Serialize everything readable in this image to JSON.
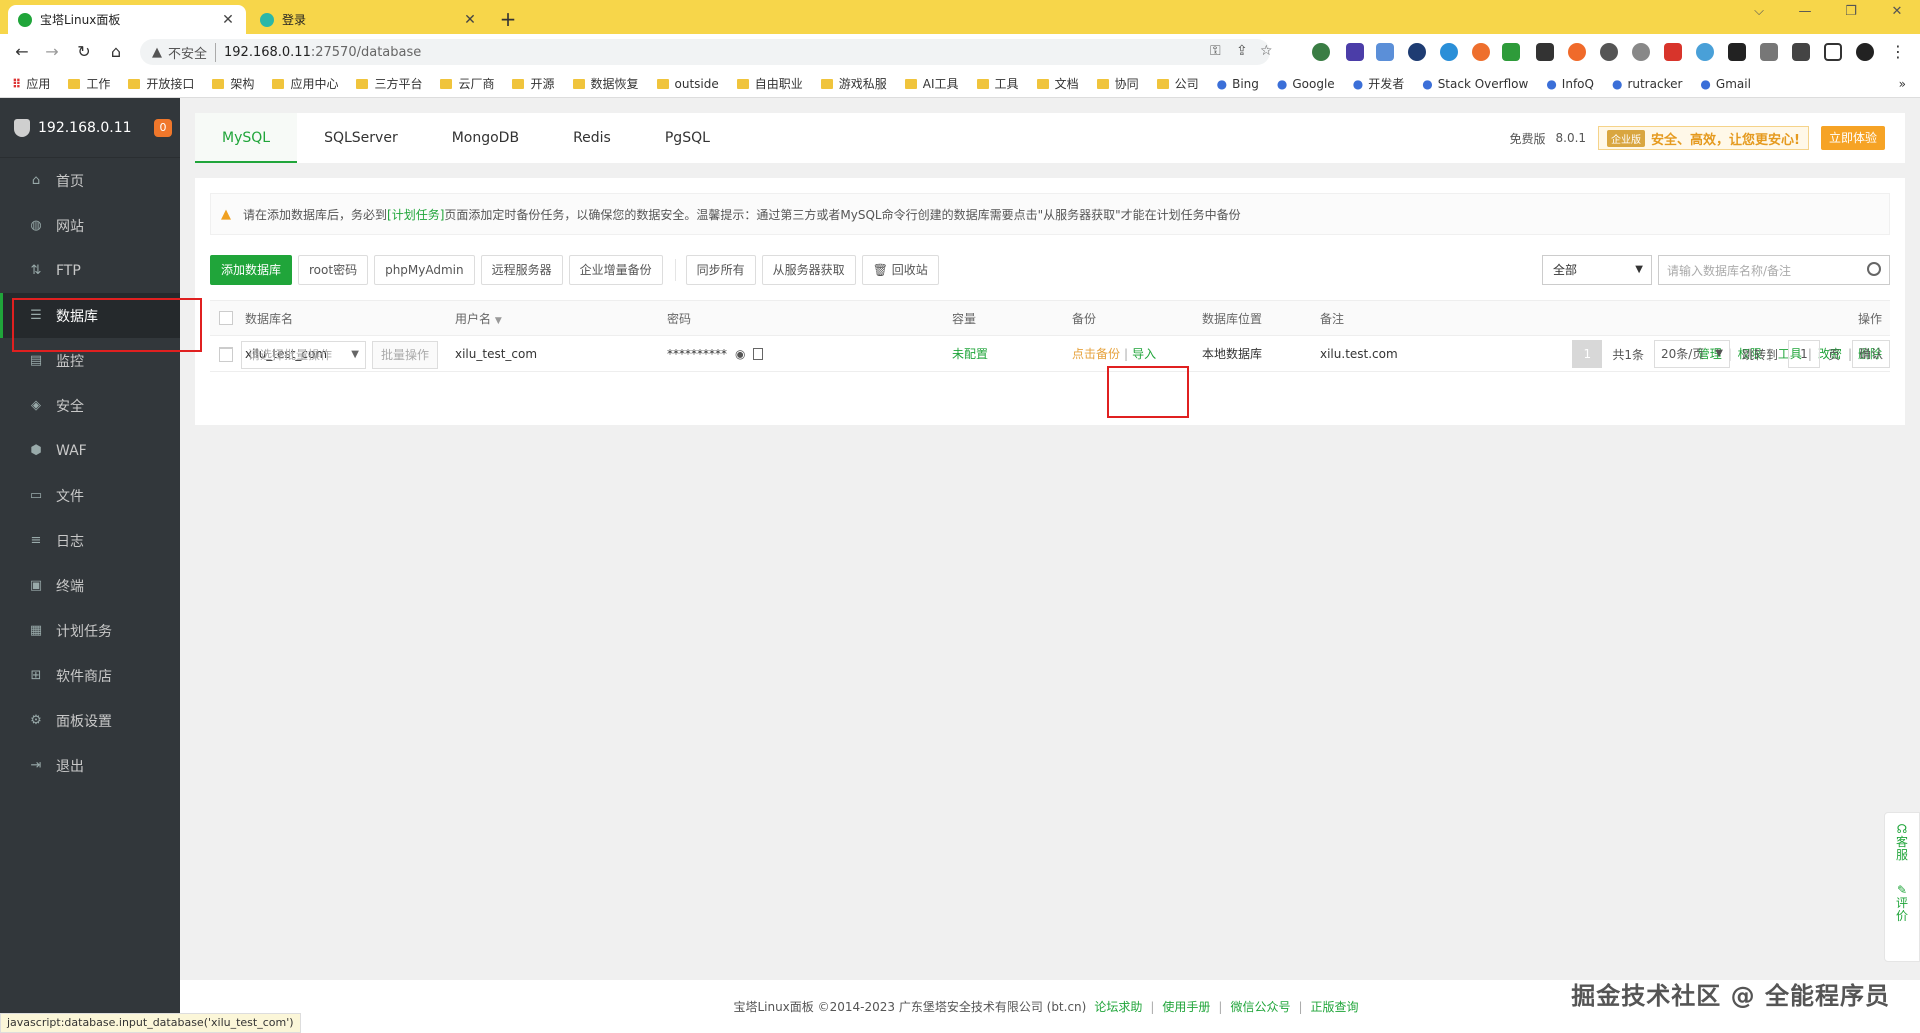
{
  "browser": {
    "tabs": [
      {
        "title": "宝塔Linux面板",
        "active": true
      },
      {
        "title": "登录",
        "active": false
      }
    ],
    "new_tab": "+",
    "window_controls": [
      "⌵",
      "—",
      "❐",
      "✕"
    ],
    "security_label": "不安全",
    "url_host": "192.168.0.11",
    "url_path": ":27570/database",
    "bookmarks": [
      {
        "label": "应用",
        "type": "apps"
      },
      {
        "label": "工作",
        "type": "folder"
      },
      {
        "label": "开放接口",
        "type": "folder"
      },
      {
        "label": "架构",
        "type": "folder"
      },
      {
        "label": "应用中心",
        "type": "folder"
      },
      {
        "label": "三方平台",
        "type": "folder"
      },
      {
        "label": "云厂商",
        "type": "folder"
      },
      {
        "label": "开源",
        "type": "folder"
      },
      {
        "label": "数据恢复",
        "type": "folder"
      },
      {
        "label": "outside",
        "type": "folder"
      },
      {
        "label": "自由职业",
        "type": "folder"
      },
      {
        "label": "游戏私服",
        "type": "folder"
      },
      {
        "label": "AI工具",
        "type": "folder"
      },
      {
        "label": "工具",
        "type": "folder"
      },
      {
        "label": "文档",
        "type": "folder"
      },
      {
        "label": "协同",
        "type": "folder"
      },
      {
        "label": "公司",
        "type": "folder"
      },
      {
        "label": "Bing",
        "type": "site"
      },
      {
        "label": "Google",
        "type": "site"
      },
      {
        "label": "开发者",
        "type": "site"
      },
      {
        "label": "Stack Overflow",
        "type": "site"
      },
      {
        "label": "InfoQ",
        "type": "site"
      },
      {
        "label": "rutracker",
        "type": "site"
      },
      {
        "label": "Gmail",
        "type": "site"
      }
    ],
    "bookmarks_more": "»",
    "status_url": "javascript:database.input_database('xilu_test_com')"
  },
  "sidebar": {
    "server_ip": "192.168.0.11",
    "badge": "0",
    "items": [
      {
        "label": "首页",
        "icon": "home-icon",
        "glyph": "⌂"
      },
      {
        "label": "网站",
        "icon": "globe-icon",
        "glyph": "◍"
      },
      {
        "label": "FTP",
        "icon": "ftp-icon",
        "glyph": "⇅"
      },
      {
        "label": "数据库",
        "icon": "database-icon",
        "glyph": "☰",
        "active": true
      },
      {
        "label": "监控",
        "icon": "monitor-icon",
        "glyph": "▤"
      },
      {
        "label": "安全",
        "icon": "shield-icon",
        "glyph": "◈"
      },
      {
        "label": "WAF",
        "icon": "waf-icon",
        "glyph": "⬢"
      },
      {
        "label": "文件",
        "icon": "folder-icon",
        "glyph": "▭"
      },
      {
        "label": "日志",
        "icon": "log-icon",
        "glyph": "≡"
      },
      {
        "label": "终端",
        "icon": "terminal-icon",
        "glyph": "▣"
      },
      {
        "label": "计划任务",
        "icon": "schedule-icon",
        "glyph": "▦"
      },
      {
        "label": "软件商店",
        "icon": "store-icon",
        "glyph": "⊞"
      },
      {
        "label": "面板设置",
        "icon": "settings-icon",
        "glyph": "⚙"
      },
      {
        "label": "退出",
        "icon": "logout-icon",
        "glyph": "⇥"
      }
    ]
  },
  "db_tabs": [
    "MySQL",
    "SQLServer",
    "MongoDB",
    "Redis",
    "PgSQL"
  ],
  "version": {
    "edition": "免费版",
    "number": "8.0.1",
    "enterprise_tag": "企业版",
    "slogan": "安全、高效，让您更安心!",
    "try_button": "立即体验"
  },
  "notice": {
    "before": "请在添加数据库后，务必到",
    "link": "[计划任务]",
    "after": "页面添加定时备份任务，以确保您的数据安全。温馨提示：通过第三方或者MySQL命令行创建的数据库需要点击\"从服务器获取\"才能在计划任务中备份"
  },
  "toolbar": {
    "add_db": "添加数据库",
    "root_pwd": "root密码",
    "phpmyadmin": "phpMyAdmin",
    "remote": "远程服务器",
    "enterprise_backup": "企业增量备份",
    "sync_all": "同步所有",
    "fetch_server": "从服务器获取",
    "recycle": "回收站",
    "filter_value": "全部",
    "search_placeholder": "请输入数据库名称/备注"
  },
  "table": {
    "headers": [
      "数据库名",
      "用户名",
      "密码",
      "容量",
      "备份",
      "数据库位置",
      "备注",
      "操作"
    ],
    "rows": [
      {
        "name": "xilu_test_com",
        "user": "xilu_test_com",
        "password": "**********",
        "capacity": "未配置",
        "backup": "点击备份",
        "import": "导入",
        "location": "本地数据库",
        "remark": "xilu.test.com",
        "actions": [
          "管理",
          "权限",
          "工具",
          "改密",
          "删除"
        ]
      }
    ]
  },
  "batch": {
    "select_placeholder": "请选择批量操作",
    "button": "批量操作"
  },
  "pager": {
    "current": "1",
    "total": "共1条",
    "per_page": "20条/页",
    "goto_label": "跳转到",
    "goto_value": "1",
    "page_unit": "页",
    "confirm": "确认"
  },
  "footer": {
    "copyright": "宝塔Linux面板 ©2014-2023 广东堡塔安全技术有限公司 (bt.cn)",
    "links": [
      "论坛求助",
      "使用手册",
      "微信公众号",
      "正版查询"
    ]
  },
  "watermark": "掘金技术社区 @ 全能程序员",
  "float_buttons": [
    "客服",
    "评价"
  ],
  "colors": {
    "accent": "#20a53a",
    "sidebar": "#32373b",
    "warning": "#e6a23c",
    "highlight_box": "#e02020"
  }
}
